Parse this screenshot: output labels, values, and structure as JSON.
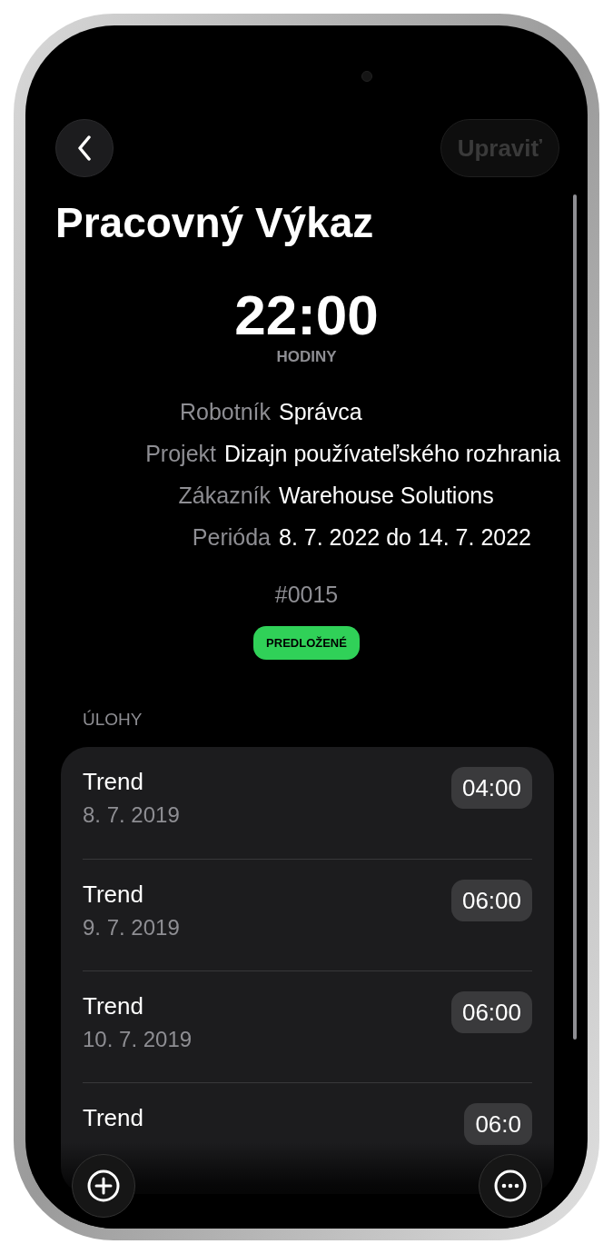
{
  "nav": {
    "edit_button": {
      "label": "Upraviť",
      "disabled": true
    }
  },
  "title": "Pracovný Výkaz",
  "hours": {
    "value": "22:00",
    "label": "HODINY"
  },
  "details": [
    {
      "label": "Robotník",
      "value": "Správca"
    },
    {
      "label": "Projekt",
      "value": "Dizajn používateľského rozhrania"
    },
    {
      "label": "Zákazník",
      "value": "Warehouse Solutions"
    },
    {
      "label": "Perióda",
      "value": "8. 7. 2022 do 14. 7. 2022"
    }
  ],
  "number": "#0015",
  "status": {
    "label": "PREDLOŽENÉ",
    "color": "#30d158"
  },
  "tasks": {
    "heading": "ÚLOHY",
    "items": [
      {
        "title": "Trend",
        "date": "8. 7. 2019",
        "time": "04:00"
      },
      {
        "title": "Trend",
        "date": "9. 7. 2019",
        "time": "06:00"
      },
      {
        "title": "Trend",
        "date": "10. 7. 2019",
        "time": "06:00"
      },
      {
        "title": "Trend",
        "time": "06:0"
      }
    ]
  }
}
